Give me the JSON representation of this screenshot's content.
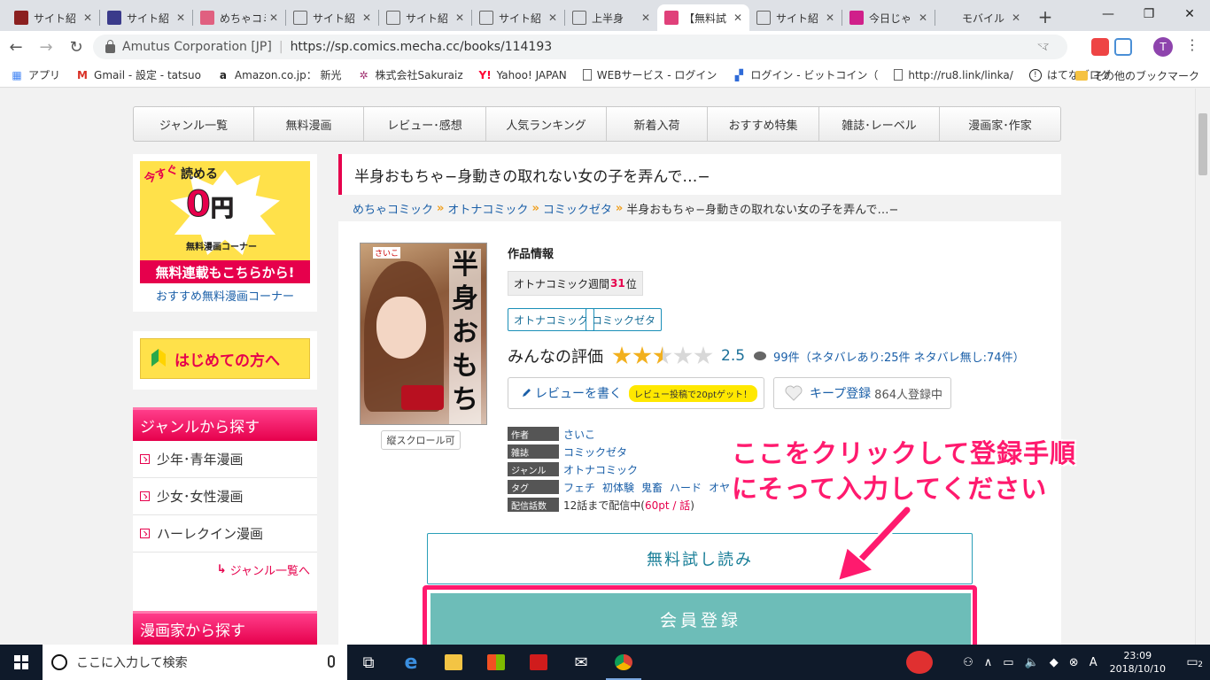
{
  "browser": {
    "tabs": [
      {
        "title": "サイト紹",
        "color": "#8b2020"
      },
      {
        "title": "サイト紹",
        "color": "#3b3b8b"
      },
      {
        "title": "めちゃコミ",
        "color": "#e06080"
      },
      {
        "title": "サイト紹",
        "color": "#666666"
      },
      {
        "title": "サイト紹",
        "color": "#666666"
      },
      {
        "title": "サイト紹",
        "color": "#666666"
      },
      {
        "title": "上半身",
        "color": "#666666"
      },
      {
        "title": "【無料試",
        "color": "#e0407a",
        "active": true
      },
      {
        "title": "サイト紹",
        "color": "#666666"
      },
      {
        "title": "今日じゃ",
        "color": "#d0208a"
      },
      {
        "title": "モバイル",
        "color": "#dee1e6"
      }
    ],
    "address": {
      "org": "Amutus Corporation [JP]",
      "url": "https://sp.comics.mecha.cc/books/114193"
    },
    "profile_initial": "T",
    "bookmarks": [
      {
        "label": "アプリ",
        "icon": "apps-grid-icon"
      },
      {
        "label": "Gmail - 設定 - tatsuo",
        "icon": "gmail-icon"
      },
      {
        "label": "Amazon.co.jp： 新光",
        "icon": "amazon-icon"
      },
      {
        "label": "株式会社Sakuraiz",
        "icon": "sakuraiz-icon"
      },
      {
        "label": "Yahoo! JAPAN",
        "icon": "yahoo-icon"
      },
      {
        "label": "WEBサービス - ログイン",
        "icon": "page-icon"
      },
      {
        "label": "ログイン - ビットコイン（",
        "icon": "bitcoin-icon"
      },
      {
        "label": "http://ru8.link/linka/",
        "icon": "page-icon"
      },
      {
        "label": "はてなブログ",
        "icon": "hatena-icon"
      }
    ],
    "bookmarks_more": "»",
    "other_bookmarks": "その他のブックマーク"
  },
  "site": {
    "nav": [
      "ジャンル一覧",
      "無料漫画",
      "レビュー･感想",
      "人気ランキング",
      "新着入荷",
      "おすすめ特集",
      "雑誌･レーベル",
      "漫画家･作家"
    ],
    "sidebar": {
      "zero_banner": {
        "ima": "今すぐ",
        "yomeru": "読める",
        "zero": "0",
        "yen": "円",
        "corner": "無料漫画コーナー",
        "bar": "無料連載もこちらから!",
        "link": "おすすめ無料漫画コーナー"
      },
      "beginner_banner": "はじめての方へ",
      "genre_heading": "ジャンルから探す",
      "genres": [
        "少年･青年漫画",
        "少女･女性漫画",
        "ハーレクイン漫画"
      ],
      "genre_more": "ジャンル一覧へ",
      "artist_heading": "漫画家から探す"
    },
    "book": {
      "title": "半身おもちゃ−身動きの取れない女の子を弄んで…−",
      "breadcrumbs": [
        "めちゃコミック",
        "オトナコミック",
        "コミックゼタ"
      ],
      "breadcrumb_current": "半身おもちゃ−身動きの取れない女の子を弄んで…−",
      "cover_title": "半身おもちゃ",
      "cover_author": "さいこ",
      "vertical_scroll": "縦スクロール可",
      "info_heading": "作品情報",
      "rank_prefix": "オトナコミック週間",
      "rank_number": "31",
      "rank_suffix": "位",
      "categories": [
        "オトナコミック",
        "コミックゼタ"
      ],
      "rating_label": "みんなの評価",
      "rating_value": 2.5,
      "rating_score": "2.5",
      "review_count": "99件（ネタバレあり:25件 ネタバレ無し:74件）",
      "review_button": "レビューを書く",
      "review_promo": "レビュー投稿で20ptゲット！",
      "keep_button": "キープ登録",
      "keep_count": "864人登録中",
      "meta": {
        "author_label": "作者",
        "author": "さいこ",
        "magazine_label": "雑誌",
        "magazine": "コミックゼタ",
        "genre_label": "ジャンル",
        "genre": "オトナコミック",
        "tags_label": "タグ",
        "tags": [
          "フェチ",
          "初体験",
          "鬼畜",
          "ハード",
          "オヤ"
        ],
        "episodes_label": "配信話数",
        "episodes": "12話まで配信中(",
        "episodes_pt": "60pt / 話",
        "episodes_close": ")"
      },
      "trial_button": "無料試し読み",
      "register_button": "会員登録"
    }
  },
  "annotation": {
    "line1": "ここをクリックして登録手順",
    "line2": "にそって入力してください",
    "color": "#ff1a6e"
  },
  "taskbar": {
    "search_placeholder": "ここに入力して検索",
    "time": "23:09",
    "date": "2018/10/10",
    "notification_count": "2",
    "ime": "A"
  }
}
